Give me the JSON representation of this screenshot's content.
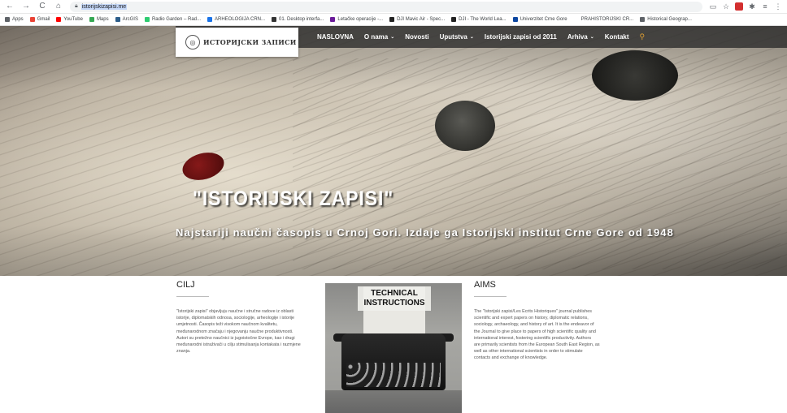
{
  "browser": {
    "url": "istorijskizapisi.me",
    "bookmarks": [
      {
        "label": "Apps",
        "color": "#5f6368"
      },
      {
        "label": "Gmail",
        "color": "#ea4335"
      },
      {
        "label": "YouTube",
        "color": "#ff0000"
      },
      {
        "label": "Maps",
        "color": "#34a853"
      },
      {
        "label": "ArcGIS",
        "color": "#2c5d8a"
      },
      {
        "label": "Radio Garden – Rad...",
        "color": "#2ecc71"
      },
      {
        "label": "ARHEOLOGIJA CRN...",
        "color": "#1a73e8"
      },
      {
        "label": "01. Desktop interfa...",
        "color": "#333333"
      },
      {
        "label": "Letačke operacije -...",
        "color": "#6a1b9a"
      },
      {
        "label": "DJI Mavic Air - Spec...",
        "color": "#222222"
      },
      {
        "label": "DJI - The World Lea...",
        "color": "#222222"
      },
      {
        "label": "Univerzitet Crne Gore",
        "color": "#0d47a1"
      },
      {
        "label": "PRAHISTORIJSKI CR...",
        "color": "#ffffff"
      },
      {
        "label": "Historical Geograp...",
        "color": "#5f6368"
      }
    ]
  },
  "site": {
    "logo_text": "ИСТОРИЈСКИ ЗАПИСИ",
    "nav": [
      {
        "label": "NASLOVNA",
        "dropdown": false
      },
      {
        "label": "O nama",
        "dropdown": true
      },
      {
        "label": "Novosti",
        "dropdown": false
      },
      {
        "label": "Uputstva",
        "dropdown": true
      },
      {
        "label": "Istorijski zapisi od 2011",
        "dropdown": false
      },
      {
        "label": "Arhiva",
        "dropdown": true
      },
      {
        "label": "Kontakt",
        "dropdown": false
      }
    ],
    "hero": {
      "title": "\"ISTORIJSKI ZAPISI\"",
      "subtitle": "Najstariji naučni časopis u Crnoj Gori. Izdaje ga Istorijski institut Crne Gore od 1948"
    },
    "cilj": {
      "title": "CILJ",
      "lines": [
        "\"Istorijski zapisi\" objavljuju naučne i stručne radove iz oblasti",
        "istorije, diplomatskih odnosa, sociologije, arheologije i istorije",
        "umjetnosti. Časopis teži visokom naučnom kvalitetu,",
        "međunarodnom značaju i njegovanju naučne produktivnosti.",
        "Autori su pretežno naučnici iz jugoistočne Evrope, kao i drugi",
        "međunarodni istraživači u cilju stimulisanja kontakata i razmjene",
        "znanja."
      ]
    },
    "technical": {
      "label_line1": "TECHNICAL",
      "label_line2": "INSTRUCTIONS"
    },
    "aims": {
      "title": "AIMS",
      "lines": [
        "The \"Istorijski zapisi/Les Ecrits Historiques\" journal publishes",
        "scientific and expert papers on history, diplomatic relations,",
        "sociology, archaeology, and history of art. It is the endeavor of",
        "the Journal to give place to papers of high scientific quality and",
        "international interest, fostering scientific productivity. Authors",
        "are primarily scientists from the European South East Region, as",
        "well as other international scientists in order to stimulate",
        "contacts and exchange of knowledge."
      ]
    }
  }
}
